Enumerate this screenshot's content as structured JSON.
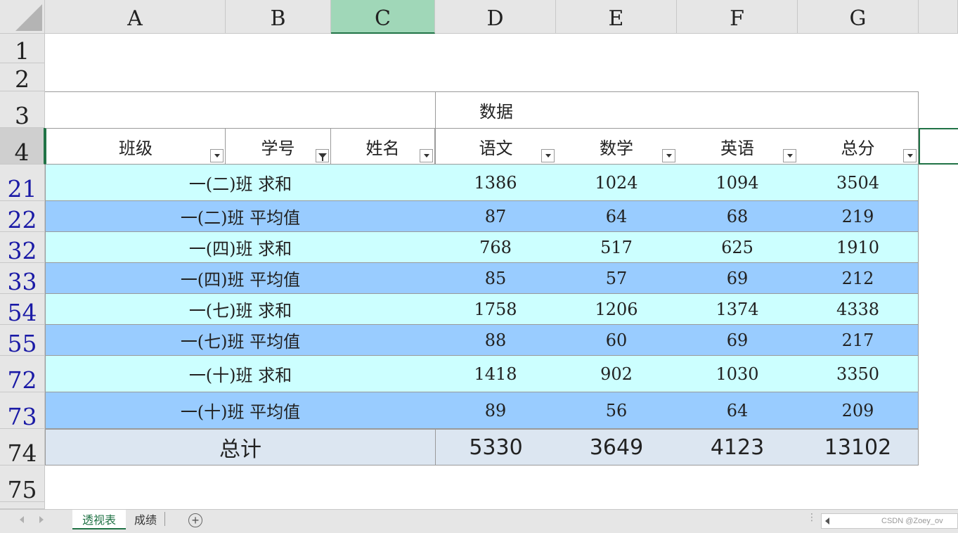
{
  "columns": [
    "A",
    "B",
    "C",
    "D",
    "E",
    "F",
    "G"
  ],
  "selected_column": "C",
  "rows": [
    "1",
    "2",
    "3",
    "4",
    "21",
    "22",
    "32",
    "33",
    "54",
    "55",
    "72",
    "73",
    "74",
    "75"
  ],
  "pivot": {
    "data_label": "数据",
    "headers": [
      "班级",
      "学号",
      "姓名",
      "语文",
      "数学",
      "英语",
      "总分"
    ],
    "body": [
      {
        "label": "一(二)班 求和",
        "values": [
          "1386",
          "1024",
          "1094",
          "3504"
        ]
      },
      {
        "label": "一(二)班 平均值",
        "values": [
          "87",
          "64",
          "68",
          "219"
        ]
      },
      {
        "label": "一(四)班 求和",
        "values": [
          "768",
          "517",
          "625",
          "1910"
        ]
      },
      {
        "label": "一(四)班 平均值",
        "values": [
          "85",
          "57",
          "69",
          "212"
        ]
      },
      {
        "label": "一(七)班 求和",
        "values": [
          "1758",
          "1206",
          "1374",
          "4338"
        ]
      },
      {
        "label": "一(七)班 平均值",
        "values": [
          "88",
          "60",
          "69",
          "217"
        ]
      },
      {
        "label": "一(十)班 求和",
        "values": [
          "1418",
          "902",
          "1030",
          "3350"
        ]
      },
      {
        "label": "一(十)班 平均值",
        "values": [
          "89",
          "56",
          "64",
          "209"
        ]
      }
    ],
    "total": {
      "label": "总计",
      "values": [
        "5330",
        "3649",
        "4123",
        "13102"
      ]
    }
  },
  "sheet_tabs": [
    "透视表",
    "成绩"
  ],
  "active_tab": "透视表",
  "watermark": "CSDN @Zoey_ov",
  "colors": {
    "light_row": "#ccffff",
    "dark_row": "#99ccff",
    "total_row": "#dce6f1",
    "accent": "#217346"
  }
}
